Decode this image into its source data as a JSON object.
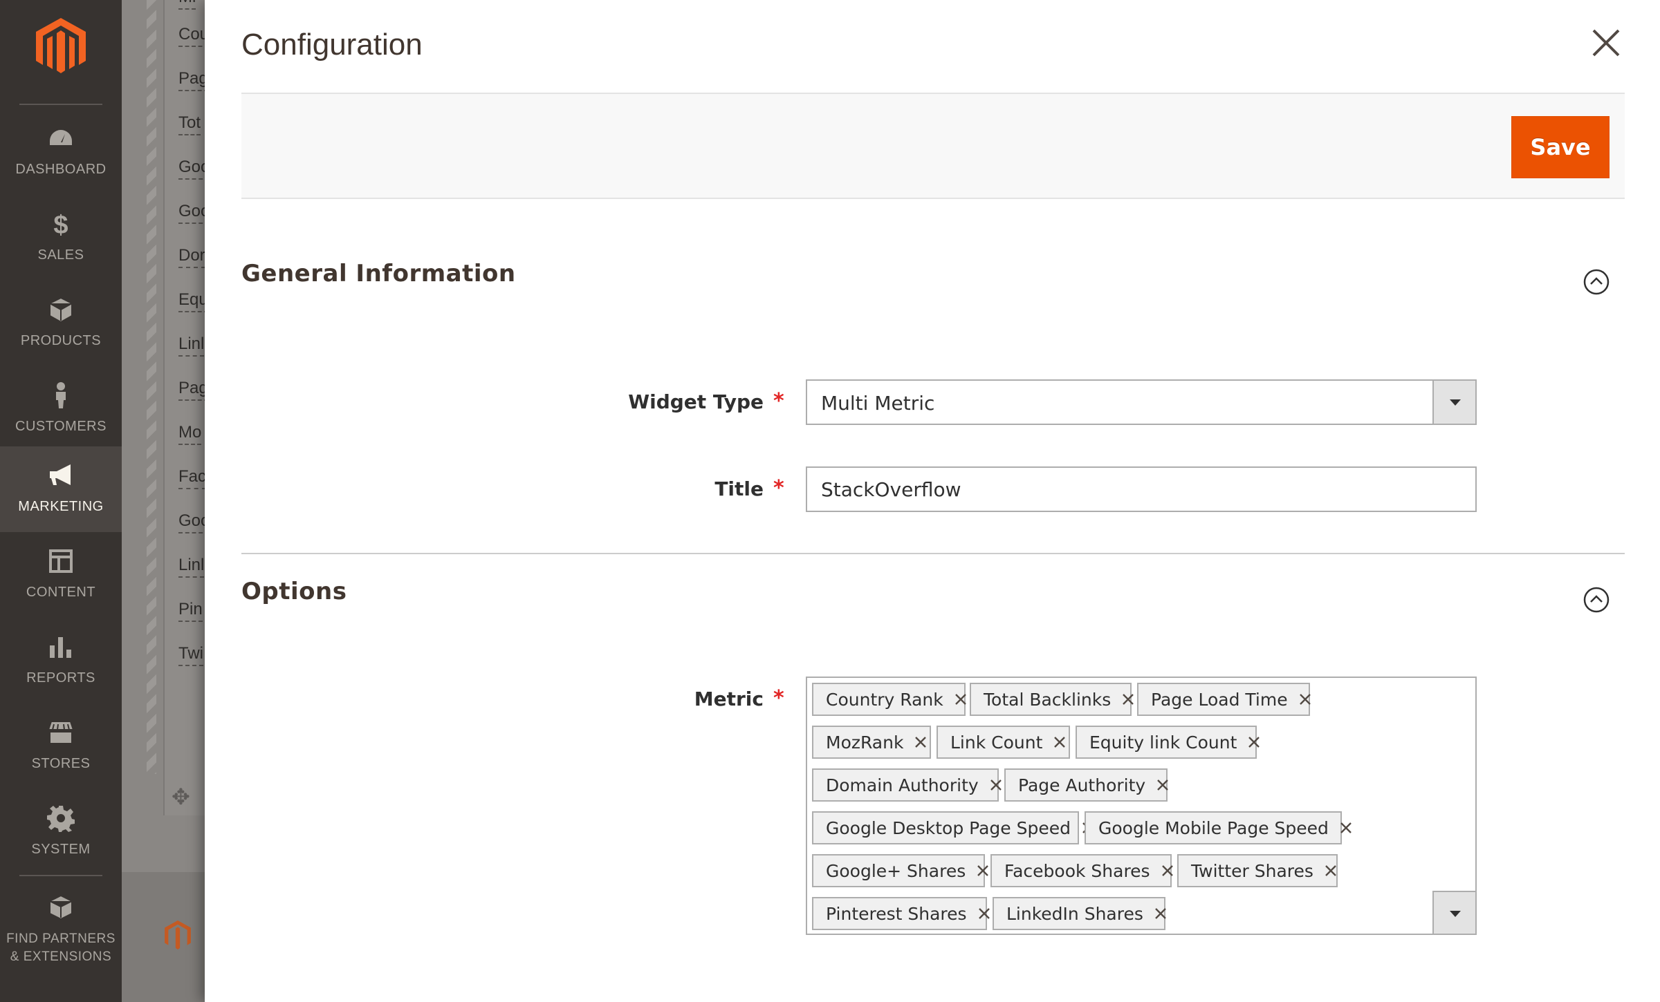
{
  "sidebar": {
    "items": [
      {
        "key": "dashboard",
        "label": "DASHBOARD",
        "icon": "dashboard-icon"
      },
      {
        "key": "sales",
        "label": "SALES",
        "icon": "dollar-icon"
      },
      {
        "key": "products",
        "label": "PRODUCTS",
        "icon": "box-icon"
      },
      {
        "key": "customers",
        "label": "CUSTOMERS",
        "icon": "person-icon"
      },
      {
        "key": "marketing",
        "label": "MARKETING",
        "icon": "megaphone-icon",
        "active": true
      },
      {
        "key": "content",
        "label": "CONTENT",
        "icon": "layout-icon"
      },
      {
        "key": "reports",
        "label": "REPORTS",
        "icon": "bar-chart-icon"
      },
      {
        "key": "stores",
        "label": "STORES",
        "icon": "storefront-icon"
      },
      {
        "key": "system",
        "label": "SYSTEM",
        "icon": "gear-icon"
      },
      {
        "key": "partners",
        "label": "FIND PARTNERS & EXTENSIONS",
        "icon": "blocks-icon"
      }
    ]
  },
  "background_page": {
    "rows": [
      "Mi",
      "Cou",
      "Pag",
      "Tot",
      "Goo",
      "Goo",
      "Dor",
      "Equ",
      "Linl",
      "Pag",
      "Mo",
      "Fac",
      "Goo",
      "Linl",
      "Pin",
      "Twi"
    ]
  },
  "modal": {
    "title": "Configuration",
    "save_label": "Save",
    "sections": {
      "general": {
        "title": "General Information"
      },
      "options": {
        "title": "Options"
      }
    },
    "fields": {
      "widget_type": {
        "label": "Widget Type",
        "value": "Multi Metric",
        "required": "*"
      },
      "title": {
        "label": "Title",
        "value": "StackOverflow",
        "required": "*"
      },
      "metric": {
        "label": "Metric",
        "required": "*",
        "selected": [
          "Country Rank",
          "Total Backlinks",
          "Page Load Time",
          "MozRank",
          "Link Count",
          "Equity link Count",
          "Domain Authority",
          "Page Authority",
          "Google Desktop Page Speed",
          "Google Mobile Page Speed",
          "Google+ Shares",
          "Facebook Shares",
          "Twitter Shares",
          "Pinterest Shares",
          "LinkedIn Shares"
        ]
      }
    }
  },
  "colors": {
    "accent": "#eb5202",
    "sidebar_bg": "#373330",
    "required": "#e22626"
  }
}
